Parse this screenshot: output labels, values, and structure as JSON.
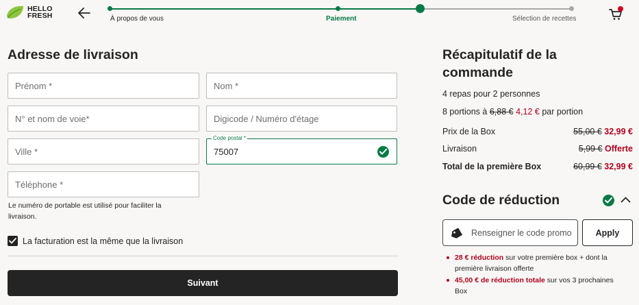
{
  "header": {
    "logo_text": "HELLO\nFRESH",
    "steps": [
      {
        "label": "À propos de vous",
        "state": "done"
      },
      {
        "label": "Paiement",
        "state": "current"
      },
      {
        "label": "Sélection de recettes",
        "state": "upcoming"
      }
    ],
    "icons": {
      "back": "arrow-left-icon",
      "cart": "cart-icon",
      "logo": "leaf-logo-icon"
    },
    "colors": {
      "green": "#067a46",
      "dark": "#242424",
      "red": "#b0021d",
      "badge": "#d0021b"
    }
  },
  "address": {
    "title": "Adresse de livraison",
    "first_name_placeholder": "Prénom *",
    "last_name_placeholder": "Nom *",
    "street_placeholder": "N° et nom de voie*",
    "digicode_placeholder": "Digicode / Numéro d'étage",
    "city_placeholder": "Ville *",
    "postal_label": "Code postal *",
    "postal_value": "75007",
    "phone_placeholder": "Téléphone *",
    "phone_hint": "Le numéro de portable est utilisé pour faciliter la livraison.",
    "billing_same_label": "La facturation est la même que la livraison",
    "billing_same_checked": true,
    "next_label": "Suivant"
  },
  "summary": {
    "title": "Récapitulatif de la commande",
    "meals": "4 repas pour 2 personnes",
    "portions_prefix": "8 portions à",
    "portion_old": "6,88 €",
    "portion_new": "4,12 €",
    "portions_suffix": "par portion",
    "rows": [
      {
        "label": "Prix de la Box",
        "old": "55,00 €",
        "new": "32,99 €"
      },
      {
        "label": "Livraison",
        "old": "5,99 €",
        "new": "Offerte"
      },
      {
        "label": "Total de la première Box",
        "old": "60,99 €",
        "new": "32,99 €"
      }
    ]
  },
  "promo": {
    "title": "Code de réduction",
    "input_placeholder": "Renseigner le code promo",
    "apply_label": "Apply",
    "bullets": [
      {
        "highlight": "28 € réduction",
        "text": " sur votre première box + dont la première livraison offerte"
      },
      {
        "highlight": "45,00 € de réduction totale",
        "text": " sur vos 3 prochaines Box"
      }
    ]
  }
}
